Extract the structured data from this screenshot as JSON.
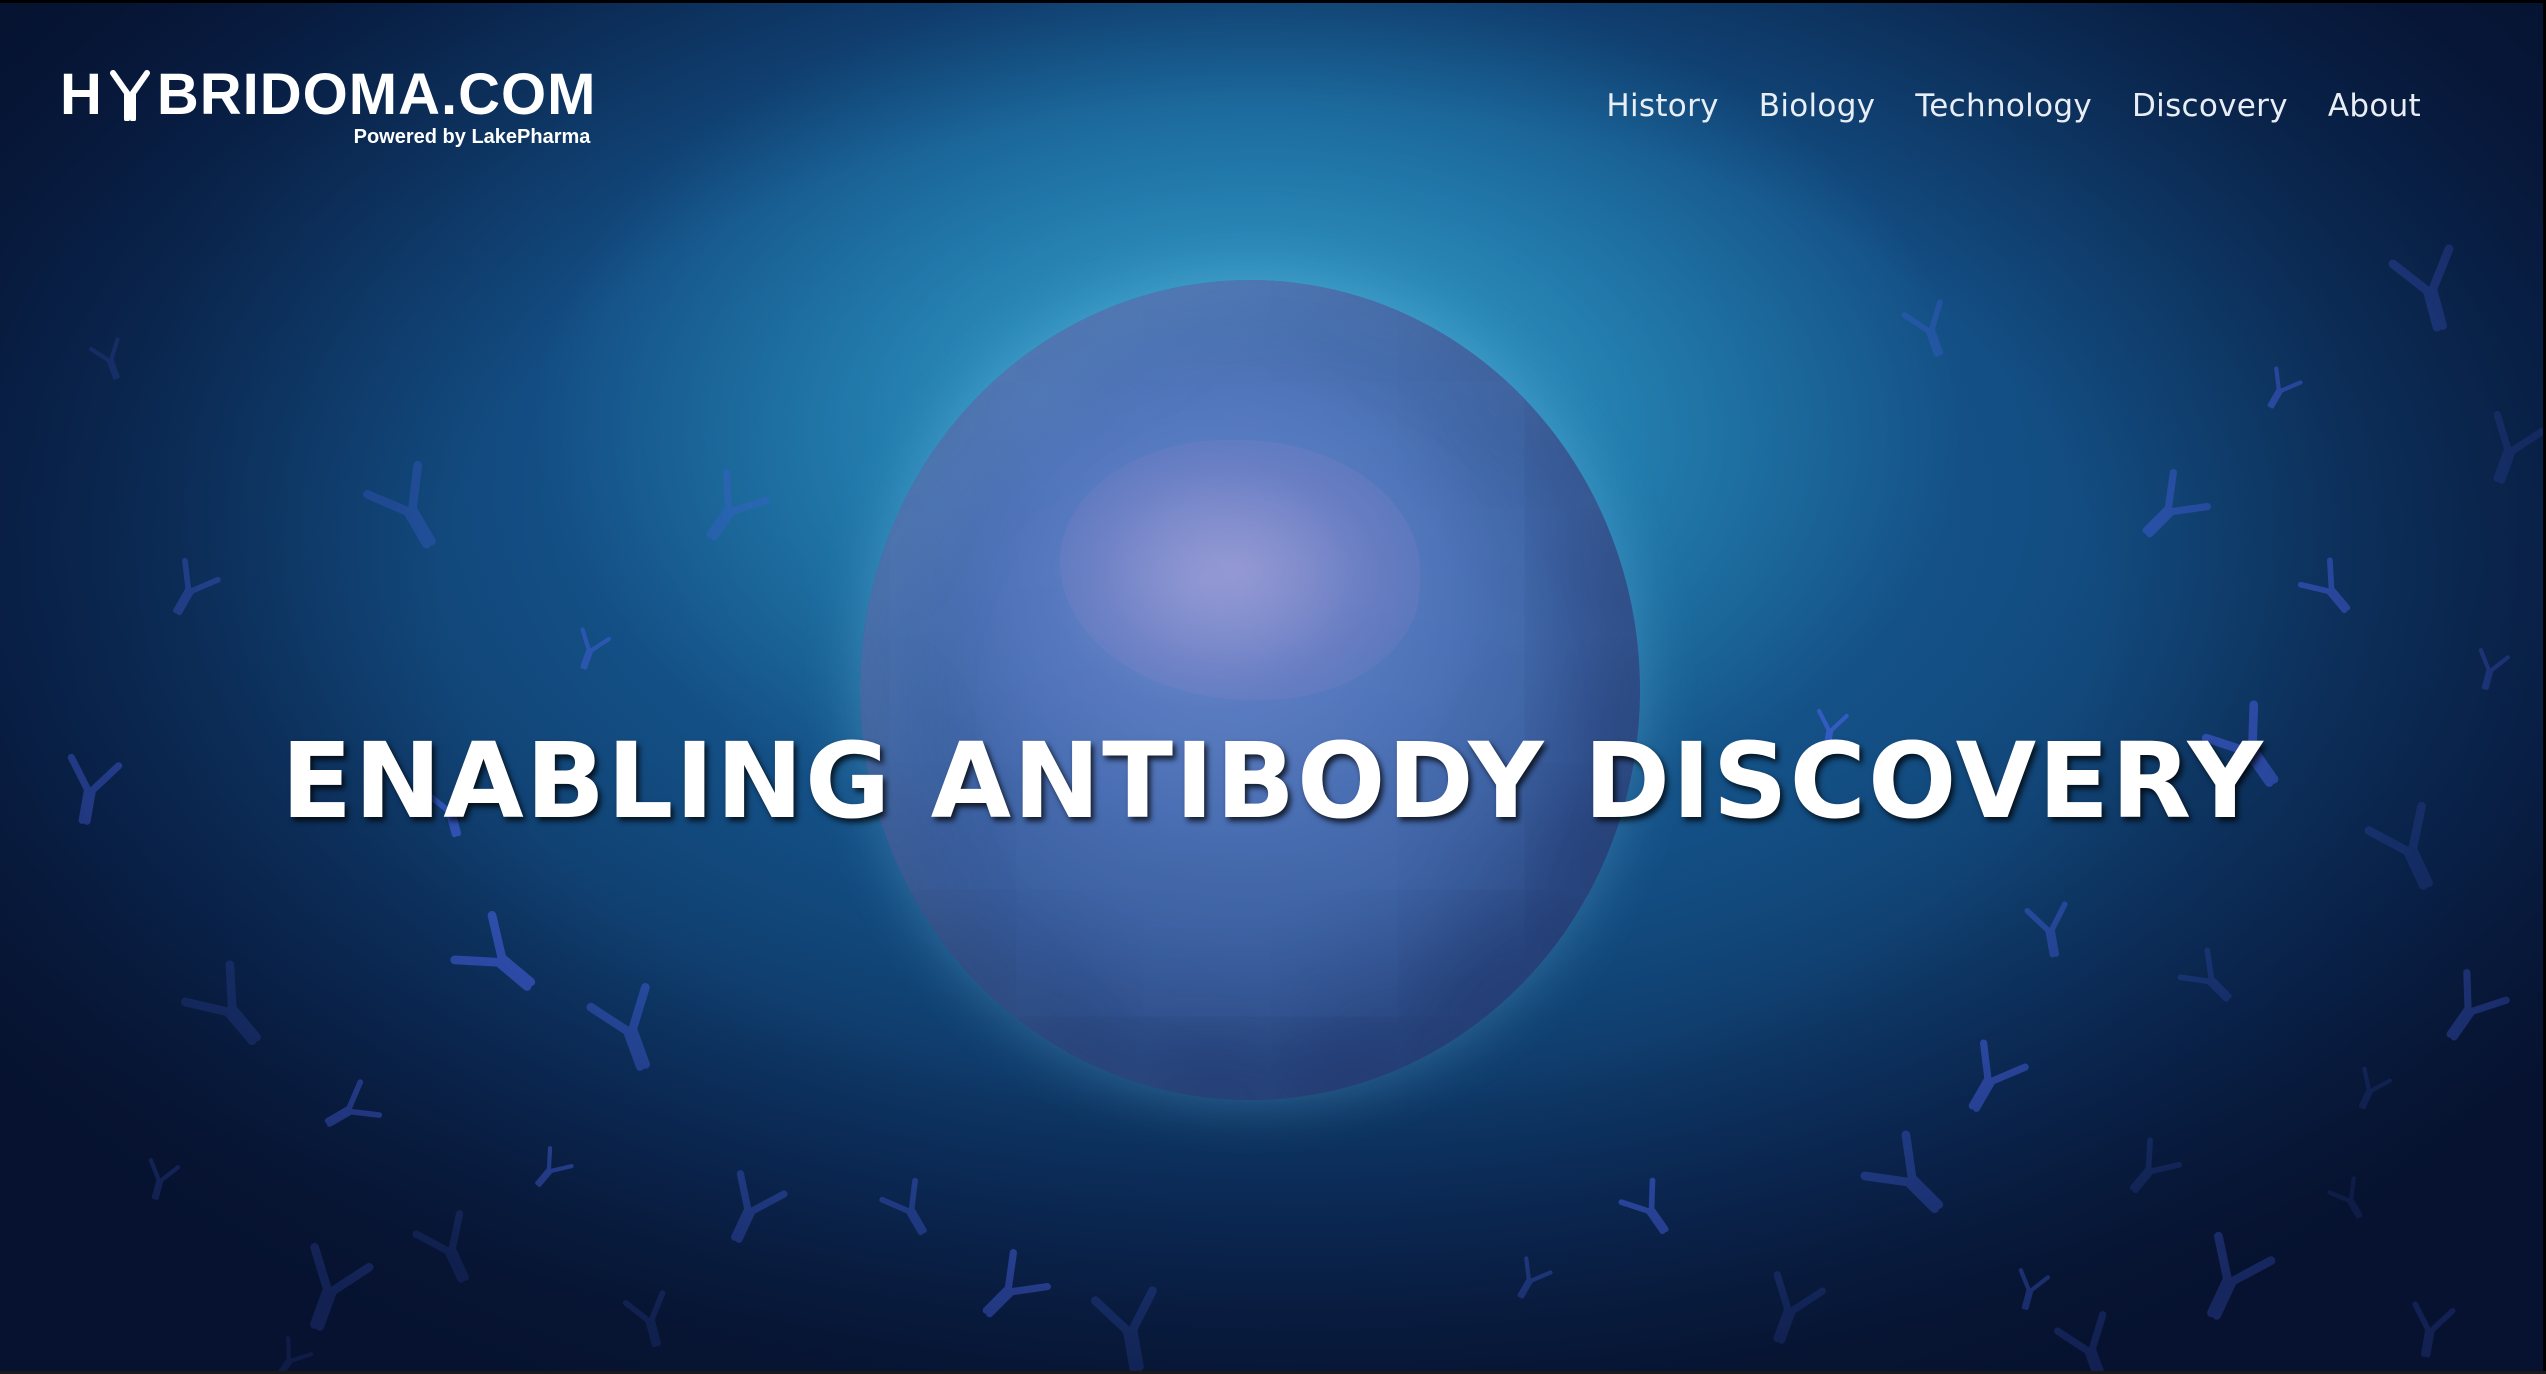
{
  "logo": {
    "prefix": "H",
    "suffix": "BRIDOMA.COM",
    "tagline": "Powered by LakePharma",
    "icon": "antibody-icon"
  },
  "nav": {
    "items": [
      {
        "label": "History"
      },
      {
        "label": "Biology"
      },
      {
        "label": "Technology"
      },
      {
        "label": "Discovery"
      },
      {
        "label": "About"
      }
    ]
  },
  "hero": {
    "headline": "ENABLING ANTIBODY DISCOVERY"
  },
  "colors": {
    "accent": "#3fb1d8",
    "text": "#ffffff",
    "background_dark": "#0a1c3c"
  }
}
